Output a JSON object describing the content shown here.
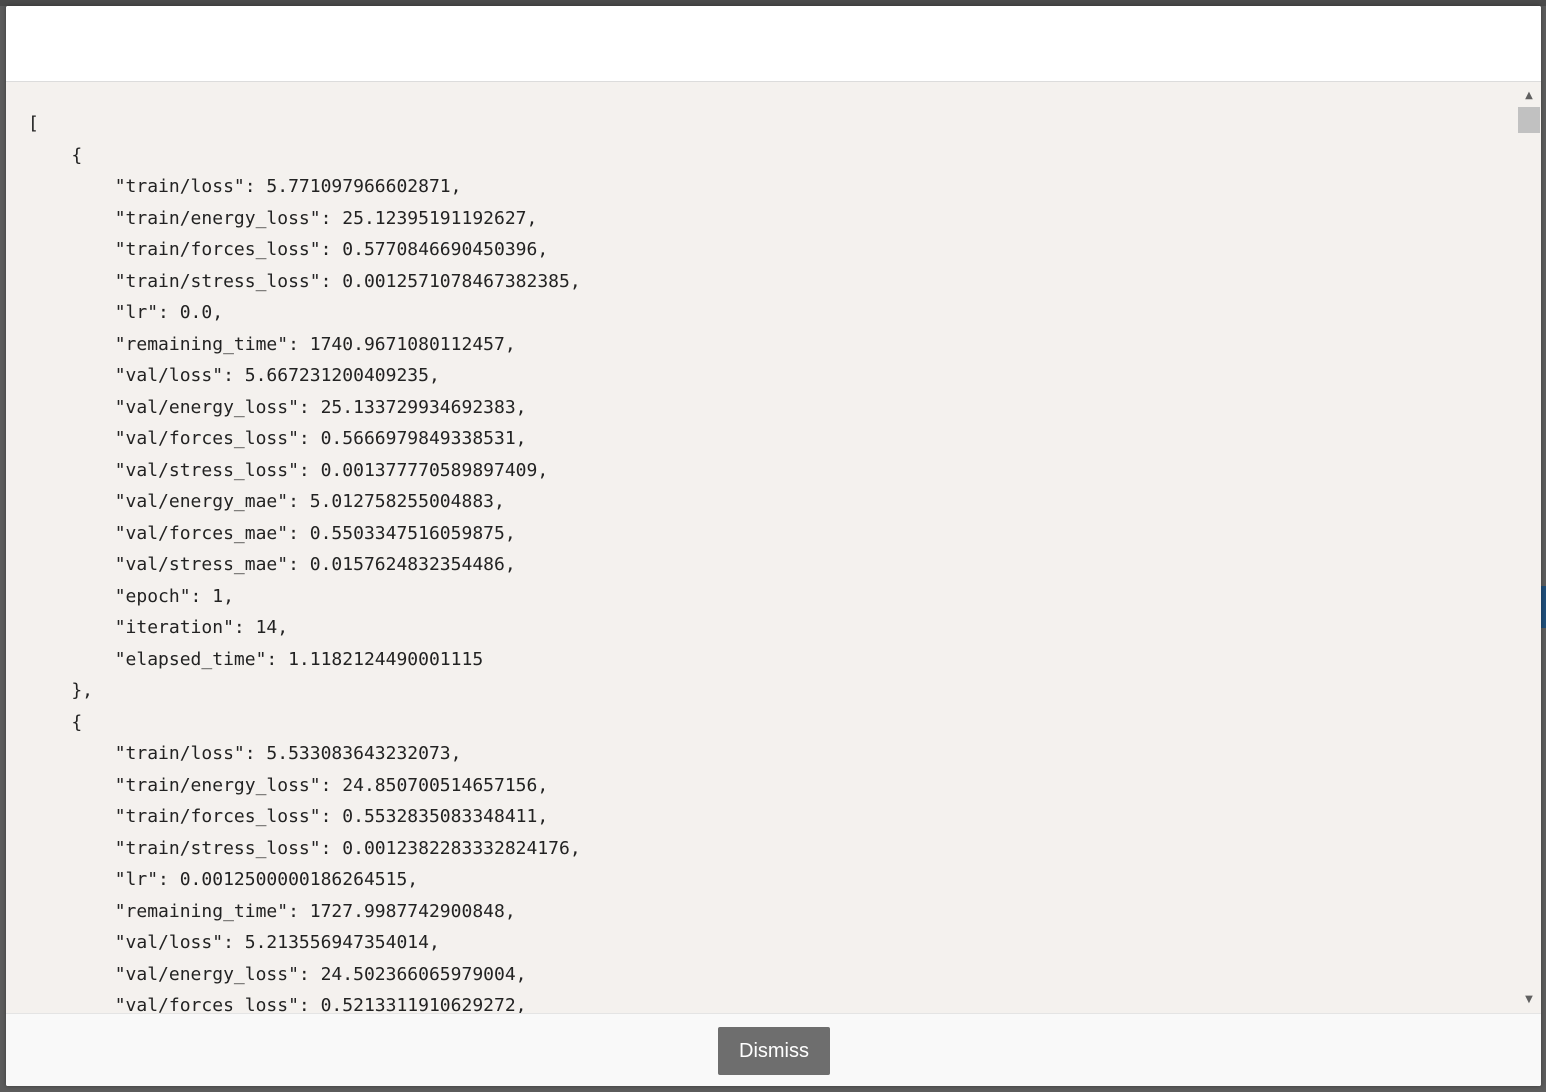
{
  "dialog": {
    "title": "",
    "json_lines": [
      "[",
      "    {",
      "        \"train/loss\": 5.771097966602871,",
      "        \"train/energy_loss\": 25.12395191192627,",
      "        \"train/forces_loss\": 0.5770846690450396,",
      "        \"train/stress_loss\": 0.0012571078467382385,",
      "        \"lr\": 0.0,",
      "        \"remaining_time\": 1740.9671080112457,",
      "        \"val/loss\": 5.667231200409235,",
      "        \"val/energy_loss\": 25.133729934692383,",
      "        \"val/forces_loss\": 0.5666979849338531,",
      "        \"val/stress_loss\": 0.001377770589897409,",
      "        \"val/energy_mae\": 5.012758255004883,",
      "        \"val/forces_mae\": 0.5503347516059875,",
      "        \"val/stress_mae\": 0.0157624832354486,",
      "        \"epoch\": 1,",
      "        \"iteration\": 14,",
      "        \"elapsed_time\": 1.1182124490001115",
      "    },",
      "    {",
      "        \"train/loss\": 5.533083643232073,",
      "        \"train/energy_loss\": 24.850700514657156,",
      "        \"train/forces_loss\": 0.5532835083348411,",
      "        \"train/stress_loss\": 0.0012382283332824176,",
      "        \"lr\": 0.0012500000186264515,",
      "        \"remaining_time\": 1727.9987742900848,",
      "        \"val/loss\": 5.213556947354014,",
      "        \"val/energy_loss\": 24.502366065979004,",
      "        \"val/forces_loss\": 0.5213311910629272,"
    ],
    "dismiss_label": "Dismiss"
  },
  "icons": {
    "scroll_up": "scroll-up-arrow-icon",
    "scroll_down": "scroll-down-arrow-icon"
  },
  "colors": {
    "body_background": "#f4f1ee",
    "button_background": "#6e6e6e",
    "overlay": "#5c5c5c"
  }
}
